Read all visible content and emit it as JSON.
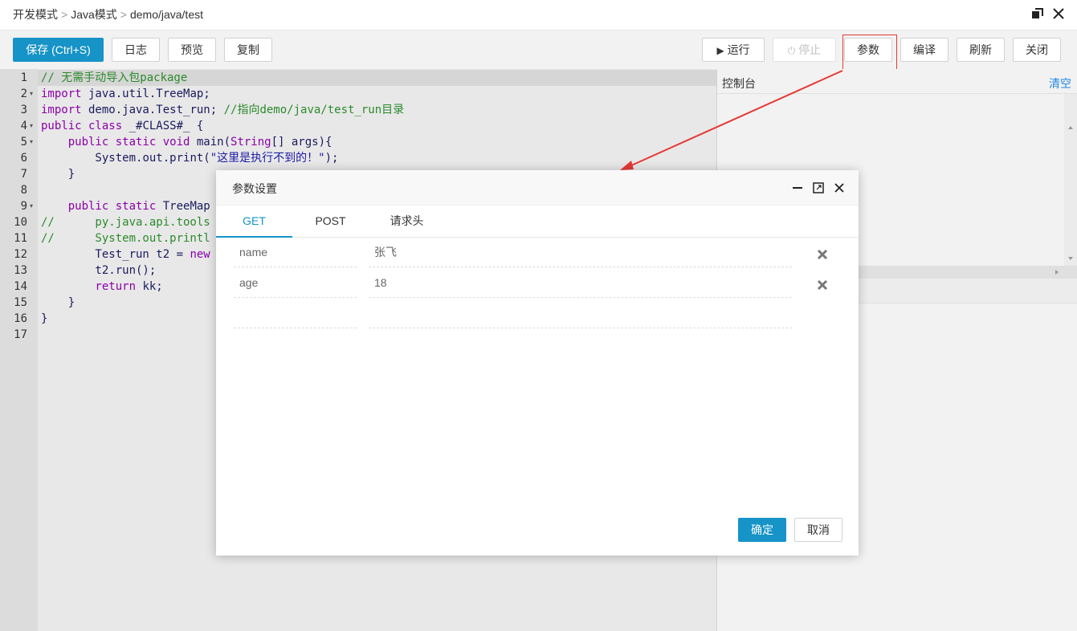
{
  "breadcrumb": {
    "part1": "开发模式",
    "sep": ">",
    "part2": "Java模式",
    "part3": "demo/java/test"
  },
  "toolbar": {
    "save": "保存 (Ctrl+S)",
    "log": "日志",
    "preview": "预览",
    "copy": "复制",
    "run": "运行",
    "stop": "停止",
    "params": "参数",
    "compile": "编译",
    "refresh": "刷新",
    "close": "关闭"
  },
  "editor": {
    "line_numbers": [
      "1",
      "2",
      "3",
      "4",
      "5",
      "6",
      "7",
      "8",
      "9",
      "10",
      "11",
      "12",
      "13",
      "14",
      "15",
      "16",
      "17"
    ],
    "lines": [
      {
        "t1": "// 无需手动导入包package"
      },
      {
        "t1": "import",
        "t2": " java.util.TreeMap;"
      },
      {
        "t1": "import",
        "t2": " demo.java.Test_run; ",
        "t3": "//指向demo/java/test_run目录"
      },
      {
        "t1": "public class",
        "t2": " _#CLASS#_ {"
      },
      {
        "t1": "    public static void",
        "t2": " main(",
        "t3": "String",
        "t4": "[] args){"
      },
      {
        "t1": "        System.",
        "t2": "out.print(",
        "t3": "\"这里是执行不到的！\"",
        "t4": ");"
      },
      {
        "t1": "    }"
      },
      {
        "t1": ""
      },
      {
        "t1": "    public static",
        "t2": " TreeMap"
      },
      {
        "t1": "//      py.java.api.tools"
      },
      {
        "t1": "//      System.out.printl"
      },
      {
        "t1": "        Test_run t2 = ",
        "t2": "new"
      },
      {
        "t1": "        t2.run();"
      },
      {
        "t1": "        return",
        "t2": " kk;"
      },
      {
        "t1": "    }"
      },
      {
        "t1": "}"
      },
      {
        "t1": ""
      }
    ]
  },
  "console": {
    "title": "控制台",
    "clear": "清空"
  },
  "dialog": {
    "title": "参数设置",
    "tabs": [
      "GET",
      "POST",
      "请求头"
    ],
    "rows": [
      {
        "key": "name",
        "value": "张飞"
      },
      {
        "key": "age",
        "value": "18"
      },
      {
        "key": "",
        "value": ""
      }
    ],
    "ok": "确定",
    "cancel": "取消"
  },
  "colors": {
    "primary": "#1693c7",
    "highlight": "#e53935",
    "comment": "#2b8a2b",
    "keyword": "#8b00a8"
  },
  "icons": [
    "restore-window-icon",
    "close-window-icon",
    "play-icon",
    "power-icon",
    "minimize-icon",
    "maximize-icon",
    "close-icon",
    "delete-x-icon",
    "arrow-annotation"
  ]
}
